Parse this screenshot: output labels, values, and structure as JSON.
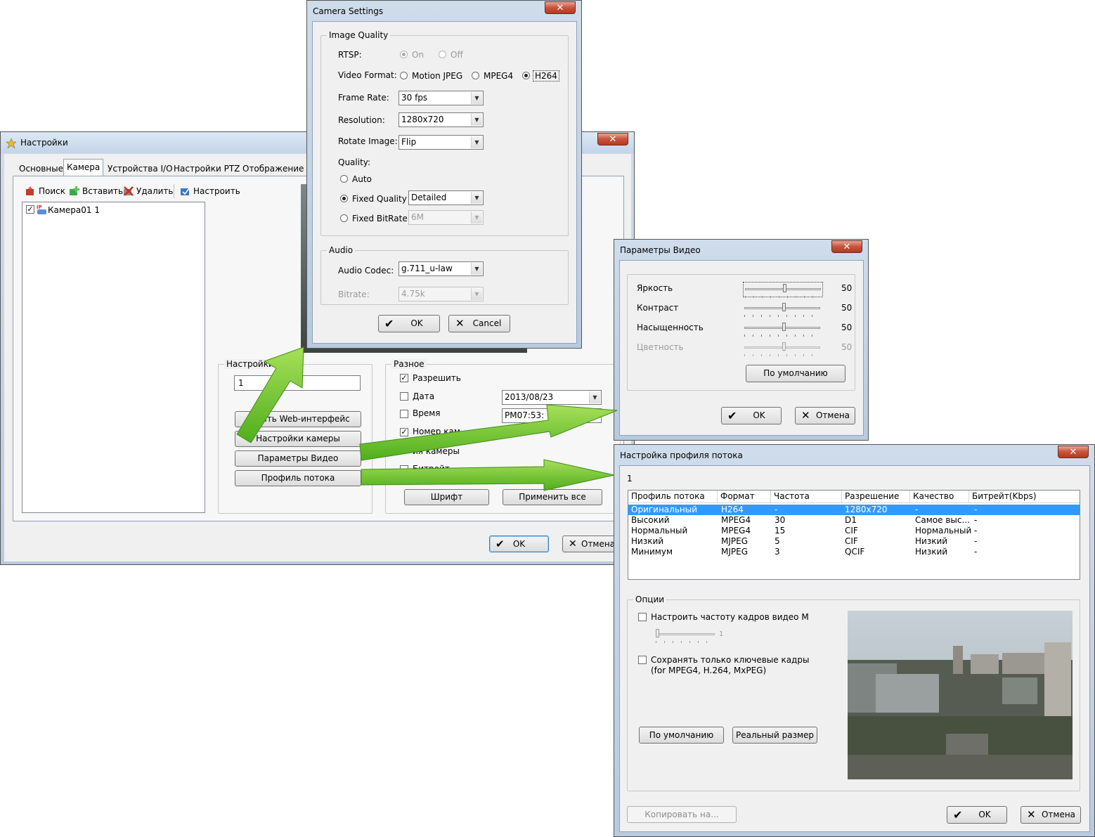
{
  "settings_window": {
    "title": "Настройки",
    "close": "✕",
    "tabs": [
      "Основные",
      "Камера",
      "Устройства I/O",
      "Настройки PTZ",
      "Отображение д"
    ],
    "toolbar": {
      "search": "Поиск",
      "insert": "Вставить",
      "delete": "Удалить",
      "configure": "Настроить"
    },
    "tree_item": "Камера01 1",
    "settings_group": {
      "label": "Настройки",
      "value": "1",
      "buttons": [
        "ыть Web-интерфейс",
        "Настройки камеры",
        "Параметры Видео",
        "Профиль потока"
      ]
    },
    "misc_group": {
      "label": "Разное",
      "allow": "Разрешить",
      "date": "Дата",
      "date_value": "2013/08/23",
      "time": "Время",
      "time_value": "PM07:53:",
      "camera_number": "Номер кам",
      "camera_name": "ия камеры",
      "bitrate": "Битрейт",
      "font_button": "Шрифт",
      "apply_all_button": "Применить все"
    },
    "ok": "OK",
    "cancel": "Отмена"
  },
  "camera_settings": {
    "title": "Camera Settings",
    "close": "✕",
    "image_quality": "Image Quality",
    "rtsp": "RTSP:",
    "rtsp_on": "On",
    "rtsp_off": "Off",
    "video_format": "Video Format:",
    "formats": [
      "Motion JPEG",
      "MPEG4",
      "H264"
    ],
    "frame_rate": "Frame Rate:",
    "frame_rate_value": "30 fps",
    "resolution": "Resolution:",
    "resolution_value": "1280x720",
    "rotate": "Rotate Image:",
    "rotate_value": "Flip",
    "quality": "Quality:",
    "auto": "Auto",
    "fixed_quality": "Fixed Quality",
    "fixed_quality_value": "Detailed",
    "fixed_bitrate": "Fixed BitRate",
    "fixed_bitrate_value": "6M",
    "audio": "Audio",
    "audio_codec": "Audio Codec:",
    "audio_codec_value": "g.711_u-law",
    "bitrate": "Bitrate:",
    "bitrate_value": "4.75k",
    "ok": "OK",
    "cancel": "Cancel"
  },
  "video_params": {
    "title": "Параметры Видео",
    "close": "✕",
    "brightness": "Яркость",
    "contrast": "Контраст",
    "saturation": "Насыщенность",
    "hue": "Цветность",
    "brightness_value": "50",
    "contrast_value": "50",
    "saturation_value": "50",
    "hue_value": "50",
    "default_button": "По умолчанию",
    "ok": "OK",
    "cancel": "Отмена"
  },
  "stream_profile": {
    "title": "Настройка профиля потока",
    "close": "✕",
    "camera_index": "1",
    "columns": [
      "Профиль потока",
      "Формат",
      "Частота кадров",
      "Разрешение",
      "Качество",
      "Битрейт(Kbps)"
    ],
    "rows": [
      [
        "Оригинальный",
        "H264",
        "-",
        "1280x720",
        "-",
        "-"
      ],
      [
        "Высокий",
        "MPEG4",
        "30",
        "D1",
        "Самое выс...",
        "-"
      ],
      [
        "Нормальный",
        "MPEG4",
        "15",
        "CIF",
        "Нормальный",
        "-"
      ],
      [
        "Низкий",
        "MJPEG",
        "5",
        "CIF",
        "Низкий",
        "-"
      ],
      [
        "Минимум",
        "MJPEG",
        "3",
        "QCIF",
        "Низкий",
        "-"
      ]
    ],
    "options": "Опции",
    "mjpeg_rate": "Настроить частоту кадров видео MJPEG",
    "mjpeg_slider_value": "1",
    "keyframes": "Сохранять только ключевые кадры",
    "keyframes_note": "(for MPEG4, H.264, MxPEG)",
    "default_button": "По умолчанию",
    "real_size_button": "Реальный размер",
    "copy_button": "Копировать на...",
    "ok": "OK",
    "cancel": "Отмена"
  },
  "colors": {
    "selection": "#3399ff",
    "arrow": "#6cc72b",
    "titlebar": "#c3d4e8"
  }
}
